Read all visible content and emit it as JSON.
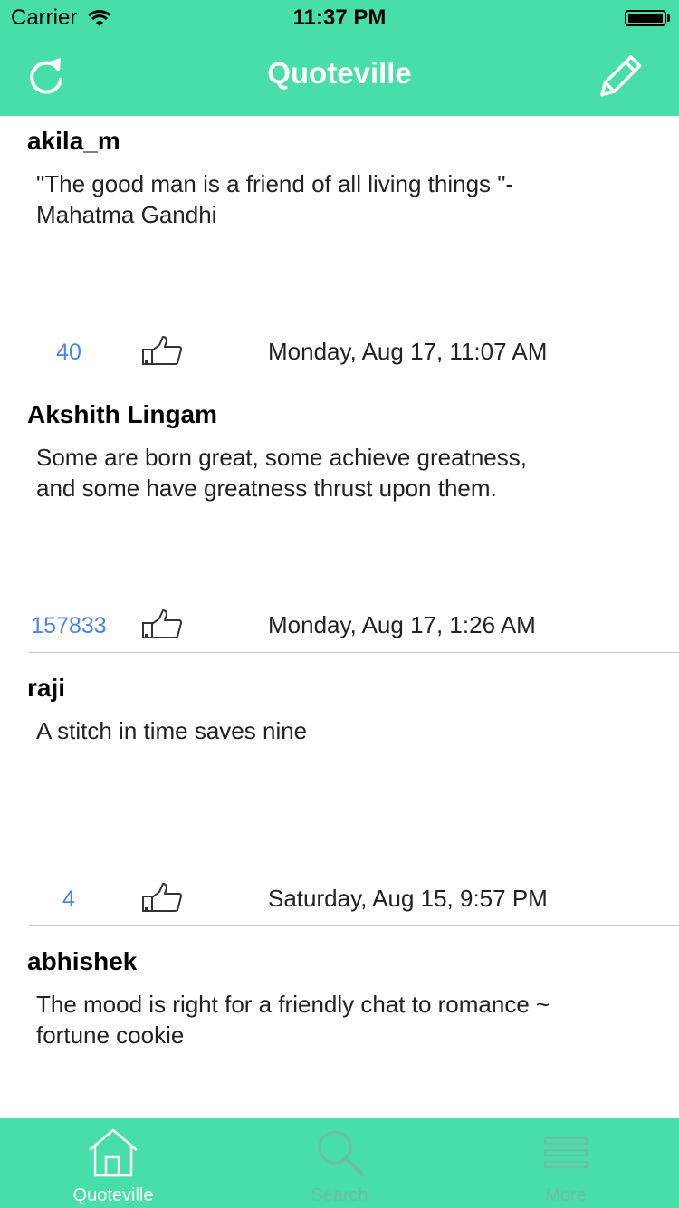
{
  "status_bar": {
    "carrier": "Carrier",
    "time": "11:37 PM"
  },
  "nav": {
    "title": "Quoteville",
    "left_icon": "refresh-icon",
    "right_icon": "pencil-icon"
  },
  "colors": {
    "brand": "#47dea9",
    "likes": "#4a86e8",
    "separator": "#c9c9c9"
  },
  "posts": [
    {
      "user": "akila_m",
      "quote": "\"The good man is a friend of all living things \"- Mahatma Gandhi",
      "likes": "40",
      "date": "Monday, Aug 17, 11:07 AM"
    },
    {
      "user": "Akshith Lingam",
      "quote": "Some are born great, some achieve greatness, and some have greatness thrust upon them.",
      "likes": "157833",
      "date": "Monday, Aug 17, 1:26 AM"
    },
    {
      "user": "raji",
      "quote": "A stitch in time saves nine",
      "likes": "4",
      "date": "Saturday, Aug 15, 9:57 PM"
    },
    {
      "user": "abhishek",
      "quote": "The mood is right for a friendly chat to romance ~ fortune cookie",
      "likes": "",
      "date": ""
    }
  ],
  "tabs": [
    {
      "label": "Quoteville",
      "icon": "home-icon",
      "active": true
    },
    {
      "label": "Search",
      "icon": "search-icon",
      "active": false
    },
    {
      "label": "More",
      "icon": "menu-icon",
      "active": false
    }
  ]
}
